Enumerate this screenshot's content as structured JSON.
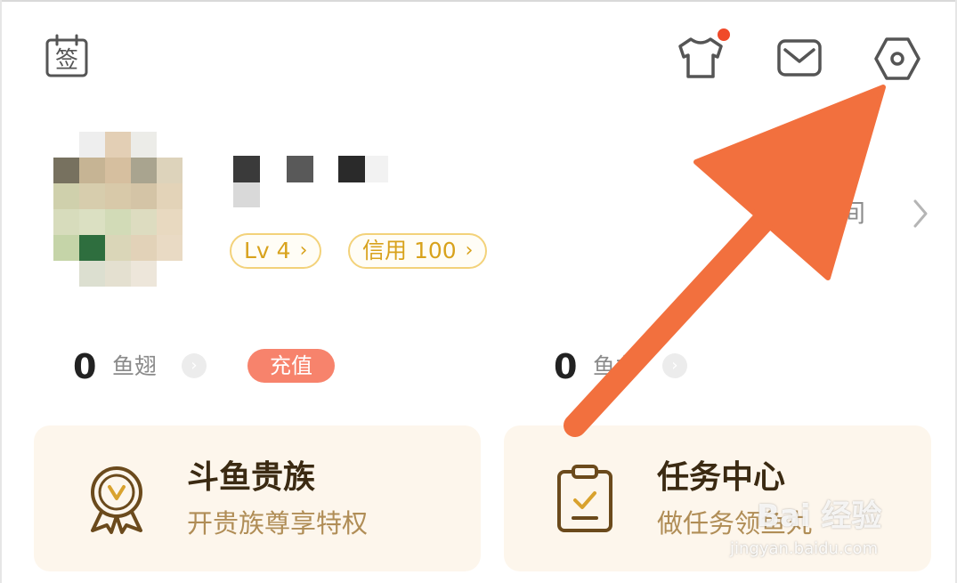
{
  "header": {
    "sign_in_icon": "calendar-sign-icon",
    "sign_in_glyph": "签",
    "outfit_icon": "tshirt-icon",
    "outfit_has_notification": true,
    "mail_icon": "mail-icon",
    "settings_icon": "settings-hex-icon"
  },
  "profile": {
    "level_label": "Lv 4",
    "credit_label": "信用 100",
    "space_link": "我的空间"
  },
  "wallet": {
    "fish_wing_count": "0",
    "fish_wing_label": "鱼翅",
    "recharge_label": "充值",
    "fish_ball_count": "0",
    "fish_ball_label": "鱼丸"
  },
  "cards": [
    {
      "title": "斗鱼贵族",
      "subtitle": "开贵族尊享特权",
      "icon": "noble-medal-icon"
    },
    {
      "title": "任务中心",
      "subtitle": "做任务领鱼丸",
      "icon": "task-clipboard-icon"
    }
  ],
  "colors": {
    "accent_orange": "#f2703e",
    "gold": "#d8a21c",
    "card_bg": "#fdf6ec",
    "recharge_bg": "#f7836c"
  },
  "watermark": {
    "text_cn": "Bai 经验",
    "text_en": "jingyan.baidu.com"
  }
}
